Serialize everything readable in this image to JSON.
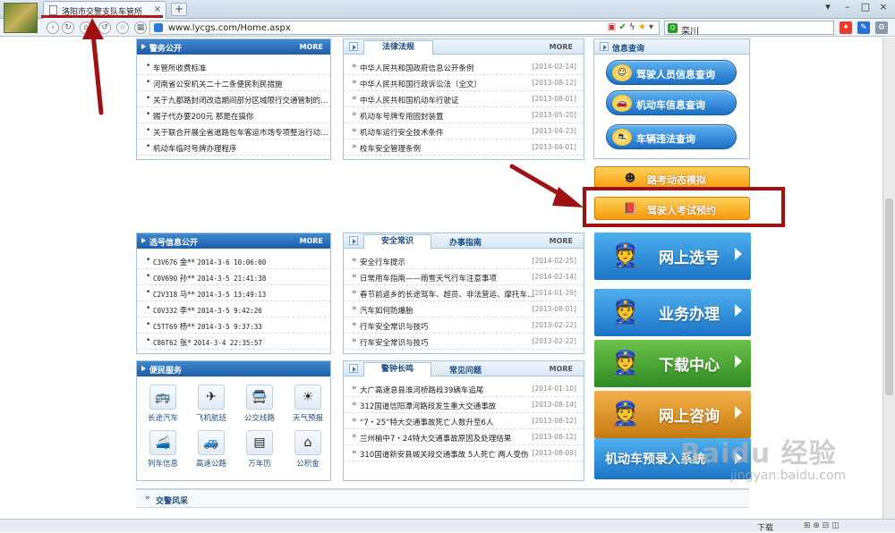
{
  "browser": {
    "tab_title": "洛阳市交警支队车管所",
    "tab_close": "×",
    "new_tab": "+",
    "url": "www.lycgs.com/Home.aspx",
    "search_value": "栾川",
    "window_controls": [
      "▾",
      "–",
      "□",
      "×"
    ]
  },
  "status_bar": {
    "download": "下载"
  },
  "panels": {
    "affairs": {
      "title": "警务公开",
      "more": "MORE",
      "items": [
        "车管所收费标准",
        "河南省公安机关二十二条便民利民措施",
        "关于九都路封闭改造期间部分区域限行交通管制的…",
        "赐子代办要200元 那是在搞你",
        "关于联合开展全省道路包车客运市场专项整治行动…",
        "机动车临时号牌办理程序"
      ]
    },
    "laws": {
      "title": "法律法规",
      "more": "MORE",
      "items": [
        {
          "text": "中华人民共和国政府信息公开条例",
          "date": "[2014-02-14]"
        },
        {
          "text": "中华人民共和国行政诉讼法（全文）",
          "date": "[2013-08-12]"
        },
        {
          "text": "中华人民共和国机动车行驶证",
          "date": "[2013-08-01]"
        },
        {
          "text": "机动车号牌专用固封装置",
          "date": "[2013-05-20]"
        },
        {
          "text": "机动车运行安全技术条件",
          "date": "[2013-04-23]"
        },
        {
          "text": "校车安全管理条例",
          "date": "[2013-04-01]"
        }
      ]
    },
    "plates": {
      "title": "选号信息公开",
      "more": "MORE",
      "items": [
        {
          "plate": "C3V676",
          "name": "金**",
          "time": "2014-3-6 10:06:00"
        },
        {
          "plate": "C0V690",
          "name": "孙**",
          "time": "2014-3-5 21:41:38"
        },
        {
          "plate": "C2V318",
          "name": "马**",
          "time": "2014-3-5 13:49:13"
        },
        {
          "plate": "C0V332",
          "name": "李**",
          "time": "2014-3-5 9:42:26"
        },
        {
          "plate": "C5TT69",
          "name": "杨**",
          "time": "2014-3-5 9:37:33"
        },
        {
          "plate": "C86T62",
          "name": "张*",
          "time": "2014-3-4 22:35:57"
        }
      ]
    },
    "safety": {
      "tab_active": "安全常识",
      "tab_other": "办事指南",
      "more": "MORE",
      "items": [
        {
          "text": "安全行车提示",
          "date": "[2014-02-25]"
        },
        {
          "text": "日常用车指南——雨雪天气行车注意事项",
          "date": "[2014-02-14]"
        },
        {
          "text": "春节前返乡的长途驾车、超员、非法营运、摩托车…",
          "date": "[2014-01-29]"
        },
        {
          "text": "汽车如何防爆胎",
          "date": "[2013-08-01]"
        },
        {
          "text": "行车安全常识与技巧",
          "date": "[2013-02-22]"
        },
        {
          "text": "行车安全常识与技巧",
          "date": "[2013-02-22]"
        }
      ]
    },
    "services": {
      "title": "便民服务",
      "items": [
        {
          "label": "长途汽车",
          "icon": "bus-icon"
        },
        {
          "label": "飞机航班",
          "icon": "plane-icon"
        },
        {
          "label": "公交线路",
          "icon": "city-bus-icon"
        },
        {
          "label": "天气预报",
          "icon": "weather-icon"
        },
        {
          "label": "列车信息",
          "icon": "train-icon"
        },
        {
          "label": "高速公路",
          "icon": "highway-car-icon"
        },
        {
          "label": "万年历",
          "icon": "calendar-icon"
        },
        {
          "label": "公积金",
          "icon": "fund-icon"
        }
      ]
    },
    "alarm": {
      "tab_active": "警钟长鸣",
      "tab_other": "常见问题",
      "more": "MORE",
      "items": [
        {
          "text": "大广高速息县淮河桥路段39辆车追尾",
          "date": "[2014-01-10]"
        },
        {
          "text": "312国道信阳潭河路段发生重大交通事故",
          "date": "[2013-08-14]"
        },
        {
          "text": "“7・25”特大交通事故死亡人数升至6人",
          "date": "[2013-08-12]"
        },
        {
          "text": "兰州榆中7・24特大交通事故原因及处理结果",
          "date": "[2013-08-12]"
        },
        {
          "text": "310国道新安县城关段交通事故 5人死亡 两人受伤",
          "date": "[2013-08-09]"
        }
      ]
    },
    "info_query": {
      "title": "信息查询",
      "buttons": [
        {
          "label": "驾驶人员信息查询",
          "icon": "driver-icon"
        },
        {
          "label": "机动车信息查询",
          "icon": "car-icon"
        },
        {
          "label": "车辆违法查询",
          "icon": "violation-icon"
        }
      ]
    }
  },
  "right_buttons": {
    "road_test": "路考动态模拟",
    "exam_booking": "驾驶人考试预约",
    "big": [
      {
        "label": "网上选号",
        "color": "#2b8fd6"
      },
      {
        "label": "业务办理",
        "color": "#2b8fd6"
      },
      {
        "label": "下载中心",
        "color": "#3c9a2f"
      },
      {
        "label": "网上咨询",
        "color": "#d18a18"
      }
    ],
    "prereg": "机动车预录入系统"
  },
  "bottom": {
    "title": "交警风采"
  },
  "watermark": {
    "brand": "Baidu 经验",
    "url": "jingyan.baidu.com"
  },
  "colors": {
    "annotation_red": "#a01212",
    "header_blue": "#1d5ea8"
  }
}
